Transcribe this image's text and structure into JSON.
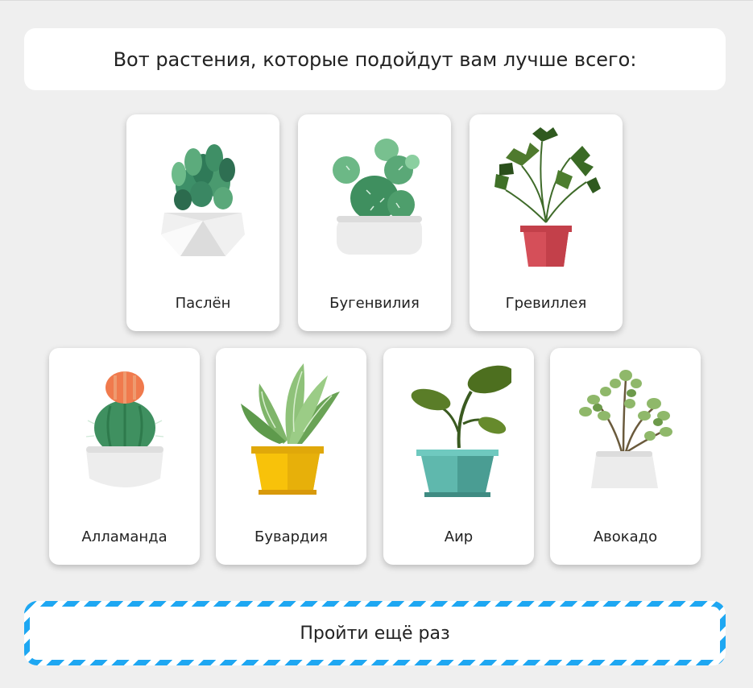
{
  "header": {
    "title": "Вот растения, которые подойдут вам лучше всего:"
  },
  "plants": [
    {
      "name": "Паслён",
      "icon": "succulent-geometric-pot-icon"
    },
    {
      "name": "Бугенвилия",
      "icon": "cactus-white-pot-icon"
    },
    {
      "name": "Гревиллея",
      "icon": "monstera-red-pot-icon"
    },
    {
      "name": "Алламанда",
      "icon": "flowering-cactus-icon"
    },
    {
      "name": "Бувардия",
      "icon": "snake-plant-yellow-pot-icon"
    },
    {
      "name": "Аир",
      "icon": "sprout-teal-pot-icon"
    },
    {
      "name": "Авокадо",
      "icon": "jade-plant-icon"
    }
  ],
  "actions": {
    "retry_label": "Пройти ещё раз"
  },
  "colors": {
    "accent": "#1ea7f2",
    "background": "#efefef",
    "card": "#ffffff"
  }
}
